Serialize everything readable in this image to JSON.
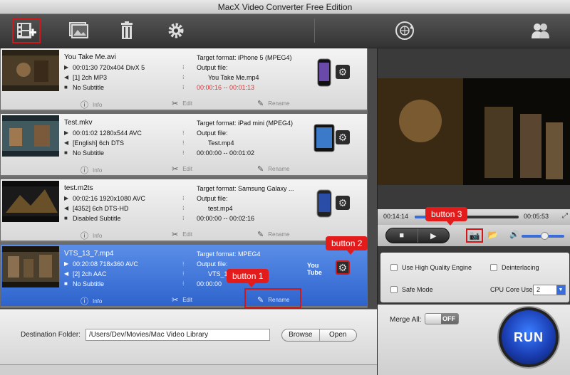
{
  "window": {
    "title": "MacX Video Converter Free Edition"
  },
  "toolbar": {
    "buttons": [
      {
        "icon": "add-video-icon"
      },
      {
        "icon": "photo-slideshow-icon"
      },
      {
        "icon": "trash-icon"
      },
      {
        "icon": "gear-icon"
      },
      {
        "icon": "update-globe-icon"
      },
      {
        "icon": "users-icon"
      }
    ]
  },
  "files": [
    {
      "name": "You Take Me.avi",
      "video": "00:01:30 720x404 DivX 5",
      "audio": "[1] 2ch MP3",
      "subtitle": "No Subtitle",
      "target_label": "Target format: iPhone 5 (MPEG4)",
      "output_label": "Output file:",
      "output_file": "You Take Me.mp4",
      "range": "00:00:16 -- 00:01:13",
      "range_red": true,
      "device": "iphone"
    },
    {
      "name": "Test.mkv",
      "video": "00:01:02 1280x544 AVC",
      "audio": "[English] 6ch DTS",
      "subtitle": "No Subtitle",
      "target_label": "Target format: iPad mini (MPEG4)",
      "output_label": "Output file:",
      "output_file": "Test.mp4",
      "range": "00:00:00 -- 00:01:02",
      "range_red": false,
      "device": "ipad"
    },
    {
      "name": "test.m2ts",
      "video": "00:02:16 1920x1080 AVC",
      "audio": "[4352] 6ch DTS-HD",
      "subtitle": "Disabled Subtitle",
      "target_label": "Target format: Samsung Galaxy ...",
      "output_label": "Output file:",
      "output_file": "test.mp4",
      "range": "00:00:00 -- 00:02:16",
      "range_red": false,
      "device": "galaxy"
    },
    {
      "name": "VTS_13_7.mp4",
      "video": "00:20:08 718x360 AVC",
      "audio": "[2] 2ch AAC",
      "subtitle": "No Subtitle",
      "target_label": "Target format: MPEG4",
      "output_label": "Output file:",
      "output_file": "VTS_1",
      "range": "00:00:00",
      "range_red": false,
      "device": "youtube"
    }
  ],
  "item_actions": {
    "info": "Info",
    "edit": "Edit",
    "rename": "Rename"
  },
  "callouts": {
    "button1": "button 1",
    "button2": "button 2",
    "button3": "button 3"
  },
  "destination": {
    "label": "Destination Folder:",
    "path": "/Users/Dev/Movies/Mac Video Library",
    "browse": "Browse",
    "open": "Open"
  },
  "player": {
    "current_time": "00:14:14",
    "total_time": "00:05:53",
    "progress": 0.35,
    "volume": 0.5
  },
  "options": {
    "high_quality": "Use High Quality Engine",
    "deinterlacing": "Deinterlacing",
    "safe_mode": "Safe Mode",
    "cpu_label": "CPU Core Use:",
    "cpu_value": "2"
  },
  "merge": {
    "label": "Merge All:",
    "state": "OFF"
  },
  "run_label": "RUN",
  "youtube_label": "You Tube"
}
